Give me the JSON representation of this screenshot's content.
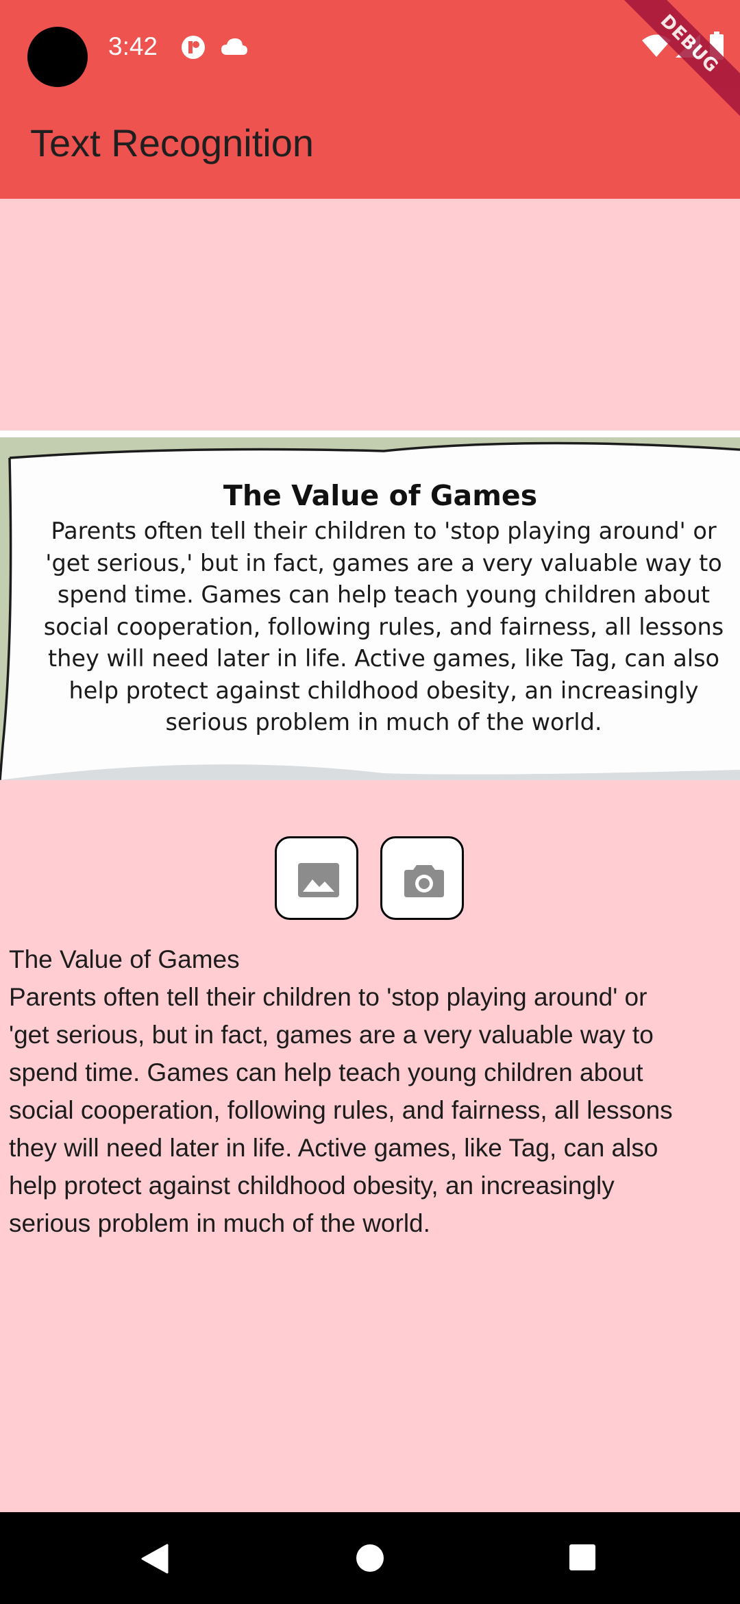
{
  "status_bar": {
    "time": "3:42"
  },
  "debug_banner": "DEBUG",
  "app_bar": {
    "title": "Text Recognition"
  },
  "image_preview": {
    "title": "The Value of Games",
    "lines": [
      "Parents often tell their children to 'stop playing around' or",
      "'get serious,' but in fact, games are a very valuable way to",
      "spend time. Games can help teach young children about",
      "social cooperation, following rules, and fairness, all lessons",
      "they will need later in life. Active games, like Tag, can also",
      "help protect against childhood obesity, an increasingly",
      "serious problem in much of the world."
    ]
  },
  "actions": {
    "gallery_icon": "image-icon",
    "camera_icon": "camera-icon"
  },
  "recognized": {
    "lines": [
      "The Value of Games",
      "Parents often tell their children to 'stop playing around' or",
      "'get serious, but in fact, games are a very valuable way to",
      "spend time. Games can help teach young children about",
      "social cooperation, following rules, and fairness, all lessons",
      "they will need later in life. Active games, like Tag, can also",
      "help protect against childhood obesity, an increasingly",
      "serious problem in much of the world."
    ]
  },
  "colors": {
    "app_bar": "#ef5350",
    "background": "#ffcdd2",
    "debug_banner": "#a4163a"
  }
}
